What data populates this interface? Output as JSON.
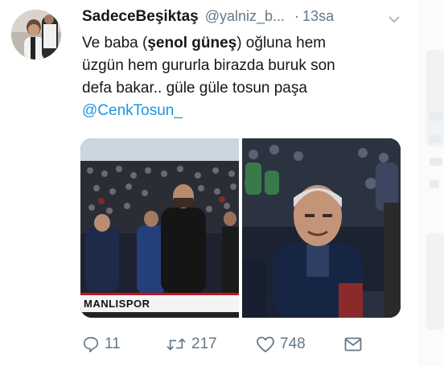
{
  "tweet": {
    "display_name": "SadeceBeşiktaş",
    "handle": "@yalniz_b...",
    "time_separator": "·",
    "time": "13sa",
    "text_line1_a": "Ve baba (",
    "text_line1_bold": "şenol güneş",
    "text_line1_b": ") oğluna hem",
    "text_line2": "üzgün hem gururla birazda buruk son",
    "text_line3": "defa bakar.. güle güle tosun paşa",
    "mention": "@CenkTosun_",
    "media_caption": "MANLISPOR",
    "actions": {
      "reply_count": "11",
      "retweet_count": "217",
      "like_count": "748"
    }
  },
  "icons": {
    "reply": "reply-icon",
    "retweet": "retweet-icon",
    "like": "heart-icon",
    "dm": "envelope-icon",
    "menu": "chevron-down-icon"
  },
  "colors": {
    "link": "#1b95e0",
    "secondary_text": "#657786",
    "primary_text": "#14171a",
    "caption_stripe": "#c0161f"
  }
}
